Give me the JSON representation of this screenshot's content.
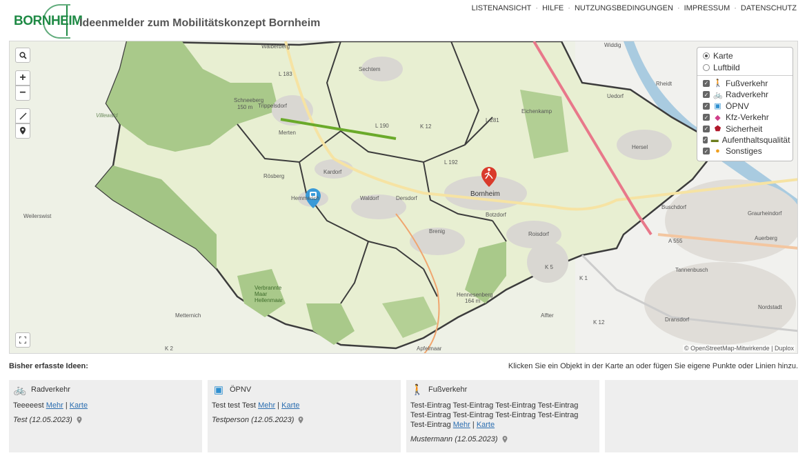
{
  "header": {
    "logo_text_1": "BORN",
    "logo_text_2": "HEIM",
    "title": "Ideenmelder zum Mobilitätskonzept Bornheim",
    "nav": [
      "LISTENANSICHT",
      "HILFE",
      "NUTZUNGSBEDINGUNGEN",
      "IMPRESSUM",
      "DATENSCHUTZ"
    ]
  },
  "map": {
    "controls": {
      "search": "search-icon",
      "zoom_in": "+",
      "zoom_out": "−",
      "draw_line": "line-icon",
      "draw_point": "marker-icon",
      "fullscreen": "fullscreen-icon"
    },
    "layers": {
      "base": [
        {
          "label": "Karte",
          "selected": true
        },
        {
          "label": "Luftbild",
          "selected": false
        }
      ],
      "overlays": [
        {
          "label": "Fußverkehr",
          "checked": true,
          "icon": "pedestrian-icon",
          "color": "#d93a2b"
        },
        {
          "label": "Radverkehr",
          "checked": true,
          "icon": "bicycle-icon",
          "color": "#5a9a22"
        },
        {
          "label": "ÖPNV",
          "checked": true,
          "icon": "bus-icon",
          "color": "#2f8fd0"
        },
        {
          "label": "Kfz-Verkehr",
          "checked": true,
          "icon": "car-icon",
          "color": "#d03f8a"
        },
        {
          "label": "Sicherheit",
          "checked": true,
          "icon": "shield-icon",
          "color": "#b0182b"
        },
        {
          "label": "Aufenthaltsqualität",
          "checked": true,
          "icon": "bench-icon",
          "color": "#6c7d1d"
        },
        {
          "label": "Sonstiges",
          "checked": true,
          "icon": "lightbulb-icon",
          "color": "#f0a020"
        }
      ]
    },
    "places": [
      "Walberberg",
      "Sechtem",
      "Widdig",
      "Rheidt",
      "Trippelsdorf",
      "Schneeberg 150 m",
      "Villewald",
      "Merten",
      "Uedorf",
      "Hersel",
      "Kardorf",
      "Rösberg",
      "Hemmerich",
      "Waldorf",
      "Dersdorf",
      "Bornheim",
      "Botzdorf",
      "Brenig",
      "Roisdorf",
      "Weilerswist",
      "Buschdorf",
      "Graurheindorf",
      "Auerberg",
      "Tannenbusch",
      "Nordstadt",
      "Metternich",
      "Alfter",
      "Dransdorf",
      "Verbrannte Maar Hellenmaar",
      "Hennesenberg 164 m",
      "Eichenkamp",
      "Apfelmaar"
    ],
    "roads": [
      "L 183",
      "L 190",
      "K 12",
      "L 281",
      "L 192",
      "A 555",
      "K 5",
      "K 1",
      "K 12",
      "K 2"
    ],
    "attribution": "© OpenStreetMap-Mitwirkende | Duplox"
  },
  "list": {
    "heading": "Bisher erfasste Ideen:",
    "hint": "Klicken Sie ein Objekt in der Karte an oder fügen Sie eigene Punkte oder Linien hinzu.",
    "more": "Mehr",
    "map_link": "Karte",
    "cards": [
      {
        "category": "Radverkehr",
        "icon": "bicycle-icon",
        "text": "Teeeeest",
        "author_date": "Test (12.05.2023)"
      },
      {
        "category": "ÖPNV",
        "icon": "bus-icon",
        "text": "Test test Test",
        "author_date": "Testperson (12.05.2023)"
      },
      {
        "category": "Fußverkehr",
        "icon": "pedestrian-icon",
        "text": "Test-Eintrag Test-Eintrag Test-Eintrag Test-Eintrag Test-Eintrag Test-Eintrag Test-Eintrag Test-Eintrag Test-Eintrag",
        "author_date": "Mustermann (12.05.2023)"
      }
    ]
  }
}
